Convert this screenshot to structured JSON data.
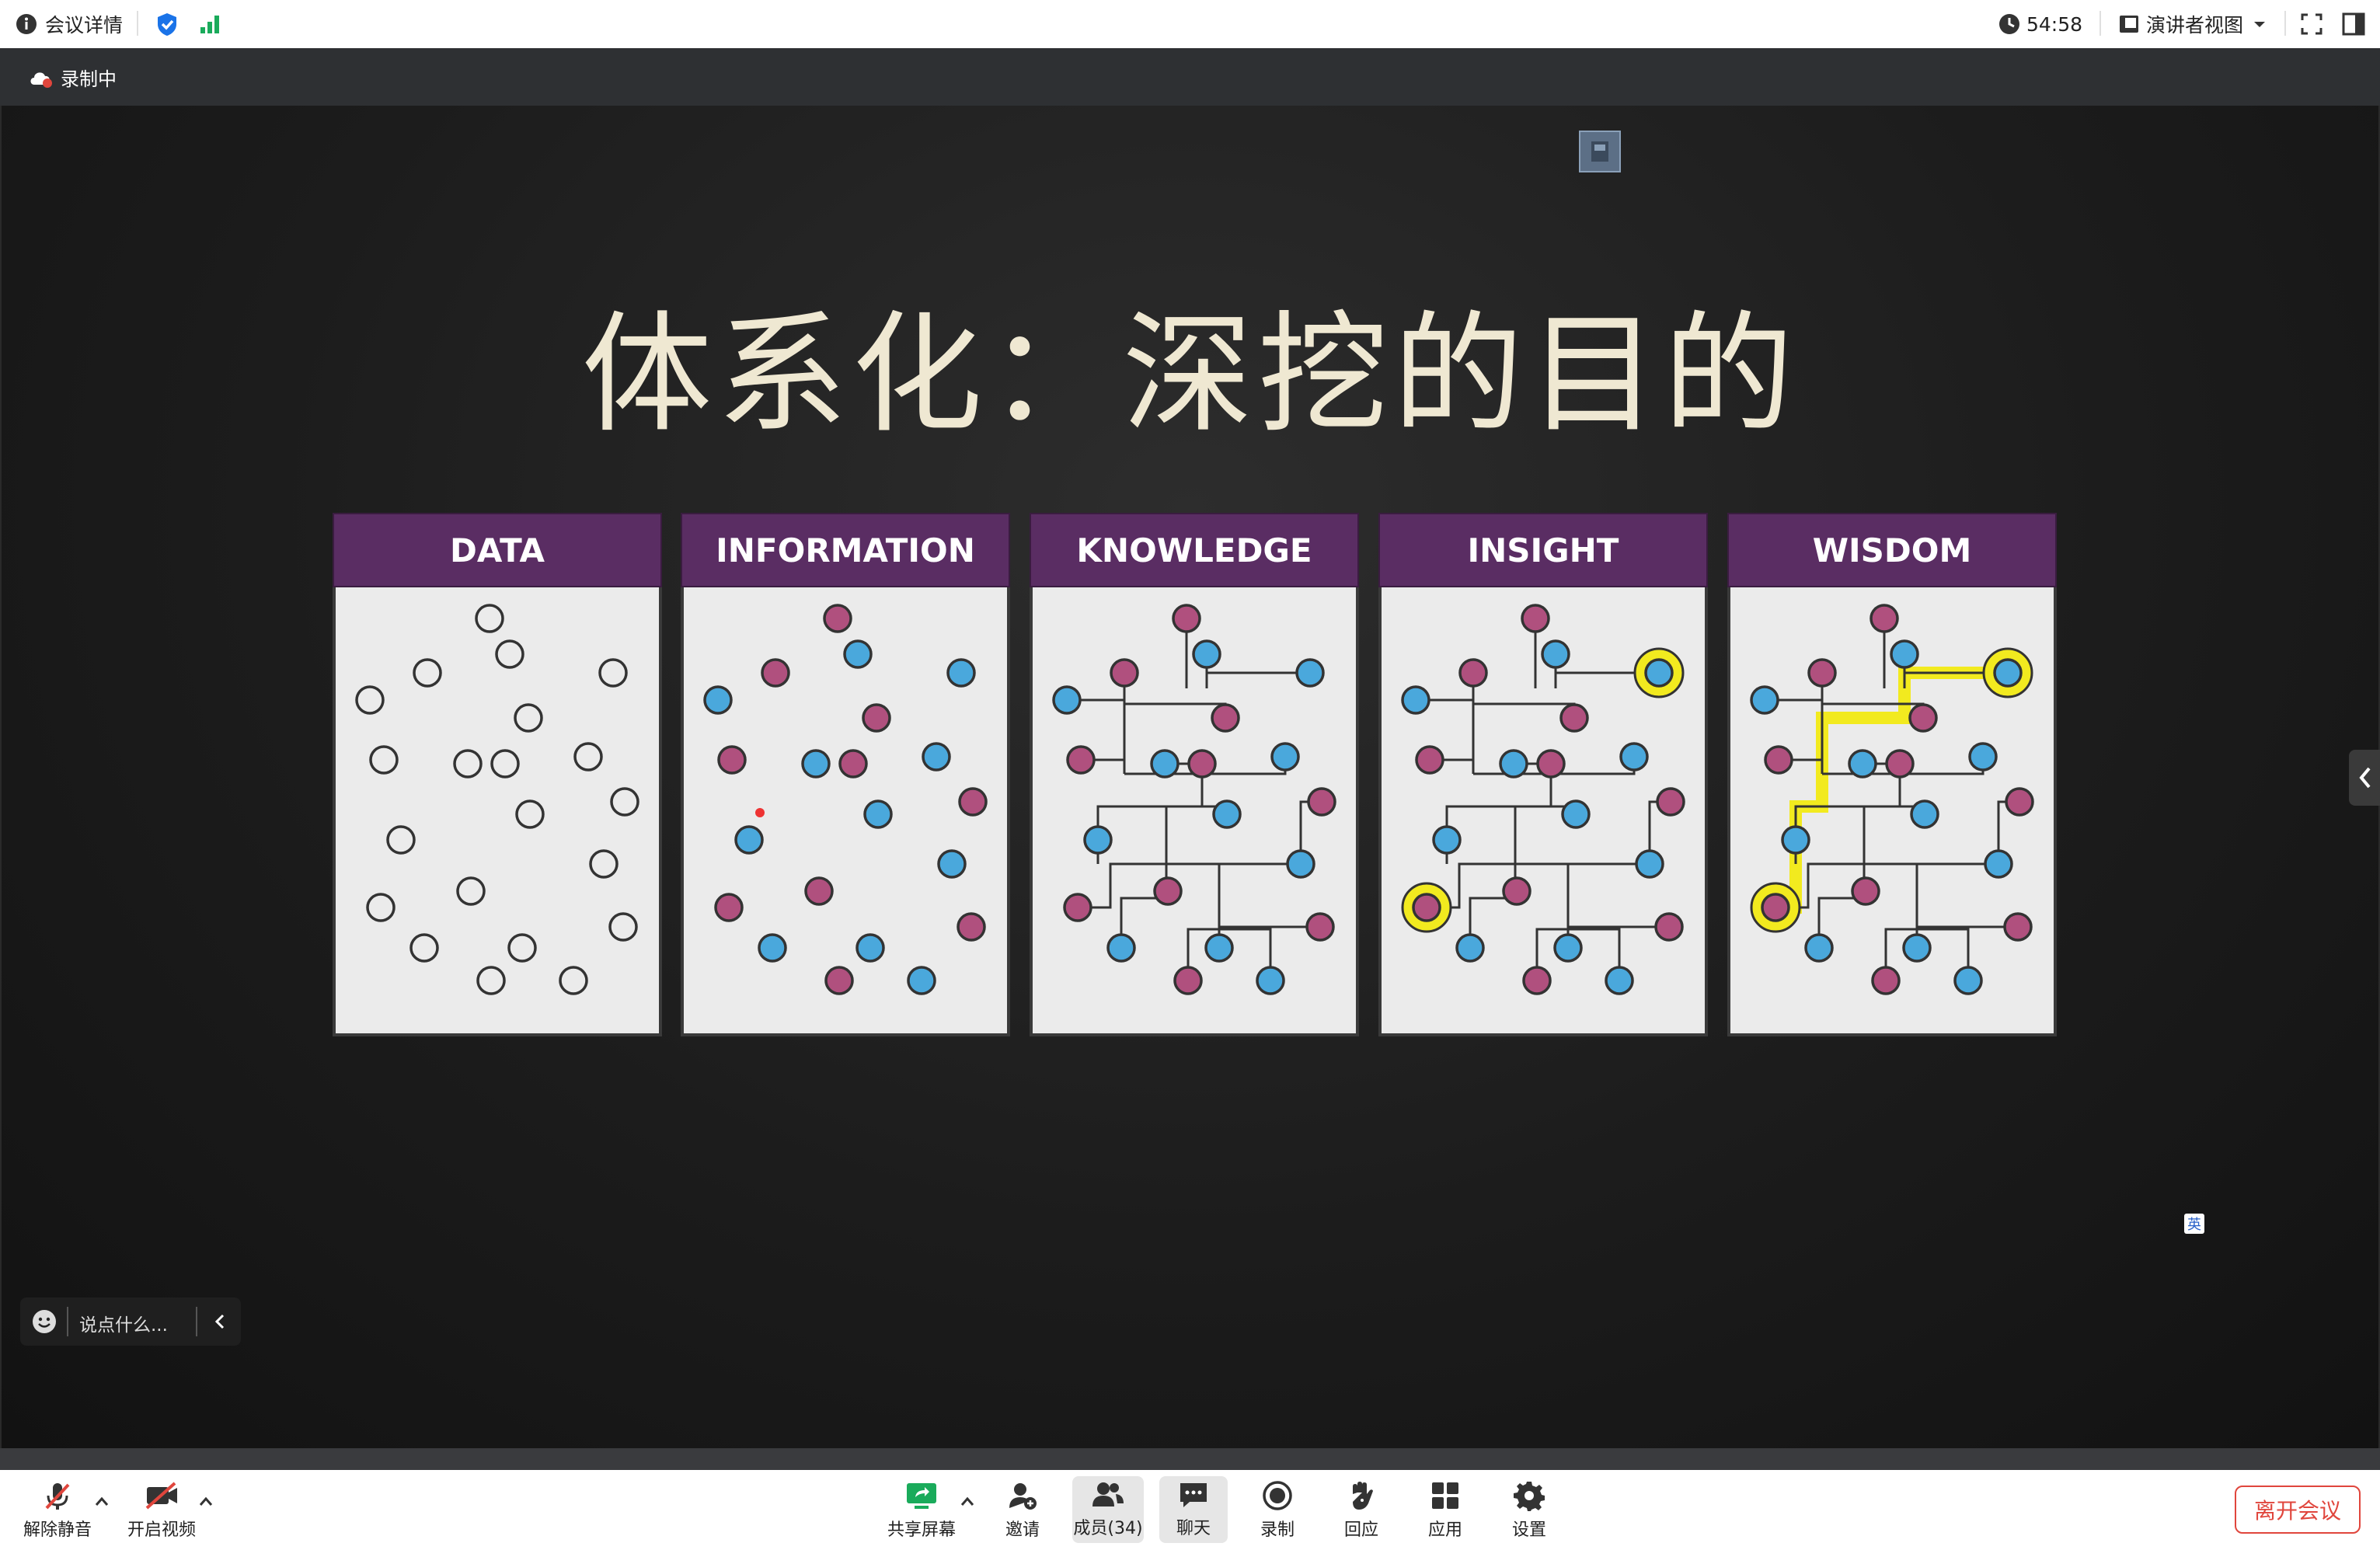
{
  "topbar": {
    "meeting_info": "会议详情",
    "timer": "54:58",
    "view_mode": "演讲者视图"
  },
  "recording": {
    "label": "录制中"
  },
  "slide": {
    "title": "体系化：深挖的目的",
    "panels": [
      {
        "title": "DATA"
      },
      {
        "title": "INFORMATION"
      },
      {
        "title": "KNOWLEDGE"
      },
      {
        "title": "INSIGHT"
      },
      {
        "title": "WISDOM"
      }
    ],
    "small_badge": "英"
  },
  "chat": {
    "placeholder": "说点什么..."
  },
  "toolbar": {
    "mute": "解除静音",
    "video": "开启视频",
    "share": "共享屏幕",
    "invite": "邀请",
    "members": "成员(34)",
    "chat": "聊天",
    "record": "录制",
    "react": "回应",
    "apps": "应用",
    "settings": "设置",
    "leave": "离开会议"
  },
  "colors": {
    "panel_header": "#5a2d63",
    "node_blue": "#4aa8dc",
    "node_magenta": "#b0507e",
    "highlight_yellow": "#f2ea1f",
    "leave_red": "#e0463d",
    "share_green": "#1aab5b"
  }
}
